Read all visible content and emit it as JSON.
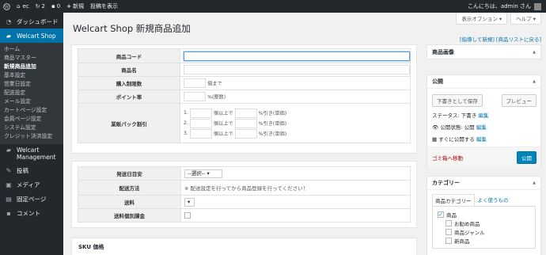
{
  "adminbar": {
    "site_name": "ec",
    "updates": "2",
    "comments": "0",
    "new_label": "新規",
    "extra_label": "投稿を表示",
    "greeting": "こんにちは、admin さん"
  },
  "sidebar": {
    "dashboard": "ダッシュボード",
    "welcart_shop": "Welcart Shop",
    "sub_items": [
      "ホーム",
      "商品マスター",
      "新規商品追加",
      "基本設定",
      "営業日設定",
      "配送設定",
      "メール設定",
      "カートページ設定",
      "会員ページ設定",
      "システム設定",
      "クレジット決済設定"
    ],
    "welcart_management": [
      "Welcart",
      "Management"
    ],
    "posts": "投稿",
    "media": "メディア",
    "pages": "固定ページ",
    "comments": "コメント"
  },
  "screen_options": "表示オプション ▾",
  "help": "ヘルプ ▾",
  "title": "Welcart Shop 新規商品追加",
  "top_links": "[指導して新規] [商品リストに戻る]",
  "basic": {
    "code_label": "商品コード",
    "name_label": "商品名",
    "limit_label": "購入制限数",
    "limit_unit": "個まで",
    "point_label": "ポイント率",
    "point_unit": "%(整数)",
    "bulk_label": "業販パック割引",
    "tiers": [
      "1.",
      "2.",
      "3."
    ],
    "tier_unit1": "個以上で",
    "tier_unit2": "%引き(単価)"
  },
  "shipping": {
    "ship_date_label": "発送日目安",
    "ship_date_value": "--選択--",
    "method_label": "配送方法",
    "method_note": "※ 配送設定を行ってから商品登録を行ってください！",
    "fee_label": "送料",
    "indiv_label": "送料個別課金"
  },
  "sku_title": "SKU 価格",
  "image_box": "商品画像",
  "publish": {
    "title": "公開",
    "save_draft": "下書きとして保存",
    "preview": "プレビュー",
    "status": "ステータス: 下書き",
    "edit": "編集",
    "visibility": "公開状態: 公開",
    "publish_when": "すぐに公開する",
    "trash": "ゴミ箱へ移動",
    "publish_btn": "公開"
  },
  "category": {
    "title": "カテゴリー",
    "tab1": "商品カテゴリー",
    "tab2": "よく使うもの",
    "items": [
      "商品",
      "お勧め商品",
      "商品ジャンル",
      "新商品"
    ]
  },
  "colors": {
    "adminbar": "#23282d",
    "sidebar": "#23282d",
    "accent": "#0073aa",
    "trash": "#a00"
  }
}
